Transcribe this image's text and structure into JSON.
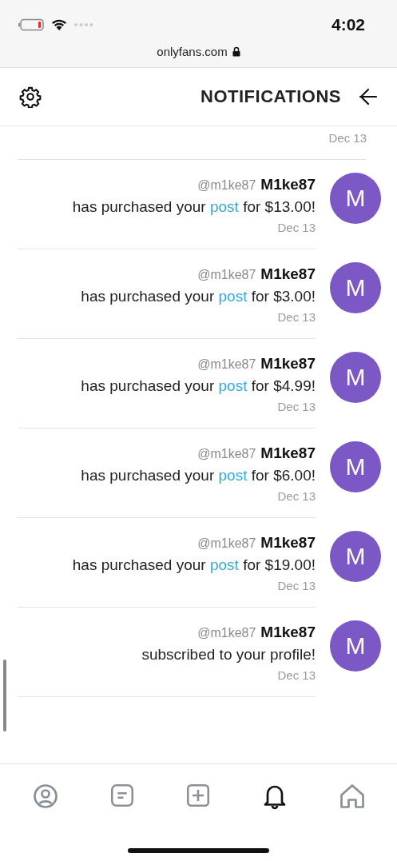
{
  "status_bar": {
    "time": "4:02"
  },
  "browser": {
    "url": "onlyfans.com"
  },
  "header": {
    "title": "NOTIFICATIONS"
  },
  "notifications": [
    {
      "kind": "date-only",
      "date": "Dec 13"
    },
    {
      "kind": "full",
      "avatar": "M",
      "name": "M1ke87",
      "handle": "@m1ke87",
      "before": "has purchased your ",
      "link": "post",
      "after": " for $13.00!",
      "date": "Dec 13"
    },
    {
      "kind": "full",
      "avatar": "M",
      "name": "M1ke87",
      "handle": "@m1ke87",
      "before": "has purchased your ",
      "link": "post",
      "after": " for $3.00!",
      "date": "Dec 13"
    },
    {
      "kind": "full",
      "avatar": "M",
      "name": "M1ke87",
      "handle": "@m1ke87",
      "before": "has purchased your ",
      "link": "post",
      "after": " for $4.99!",
      "date": "Dec 13"
    },
    {
      "kind": "full",
      "avatar": "M",
      "name": "M1ke87",
      "handle": "@m1ke87",
      "before": "has purchased your ",
      "link": "post",
      "after": " for $6.00!",
      "date": "Dec 13"
    },
    {
      "kind": "full",
      "avatar": "M",
      "name": "M1ke87",
      "handle": "@m1ke87",
      "before": "has purchased your ",
      "link": "post",
      "after": " for $19.00!",
      "date": "Dec 13"
    },
    {
      "kind": "full",
      "avatar": "M",
      "name": "M1ke87",
      "handle": "@m1ke87",
      "before": "subscribed to your profile!",
      "date": "Dec 13"
    }
  ],
  "nav": [
    {
      "kind": "home",
      "selected": false
    },
    {
      "kind": "bell",
      "selected": true
    },
    {
      "kind": "plus",
      "selected": false
    },
    {
      "kind": "messages",
      "selected": false
    },
    {
      "kind": "profile",
      "selected": false
    }
  ]
}
